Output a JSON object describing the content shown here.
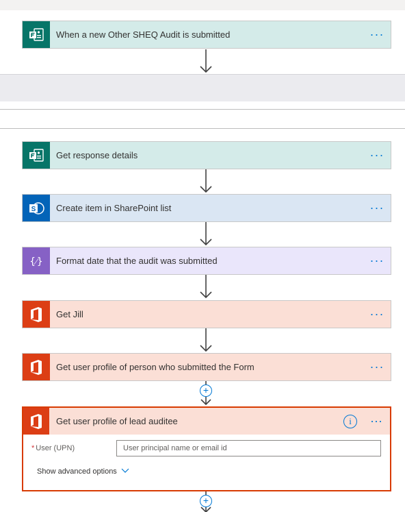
{
  "trigger": {
    "title": "When a new Other SHEQ Audit is submitted",
    "icon": "forms-icon",
    "more": "···"
  },
  "steps": [
    {
      "title": "Get response details",
      "icon": "forms-icon",
      "more": "···"
    },
    {
      "title": "Create item in SharePoint list",
      "icon": "sharepoint-icon",
      "more": "···"
    },
    {
      "title": "Format date that the audit was submitted",
      "icon": "data-operation-icon",
      "more": "···"
    },
    {
      "title": "Get Jill",
      "icon": "office365-icon",
      "more": "···"
    },
    {
      "title": "Get user profile of person who submitted the Form",
      "icon": "office365-icon",
      "more": "···"
    }
  ],
  "insert_symbol": "+",
  "expanded_step": {
    "title": "Get user profile of lead auditee",
    "icon": "office365-icon",
    "info": "i",
    "more": "···",
    "field": {
      "required_mark": "*",
      "label": "User (UPN)",
      "value": "",
      "placeholder": "User principal name or email id"
    },
    "advanced_label": "Show advanced options",
    "advanced_chevron": "﹀"
  },
  "colors": {
    "forms": "#077568",
    "sharepoint": "#0364b8",
    "data_operation": "#8661c5",
    "office365": "#dc3e15",
    "accent": "#0078d4",
    "selected_border": "#d83b01"
  }
}
